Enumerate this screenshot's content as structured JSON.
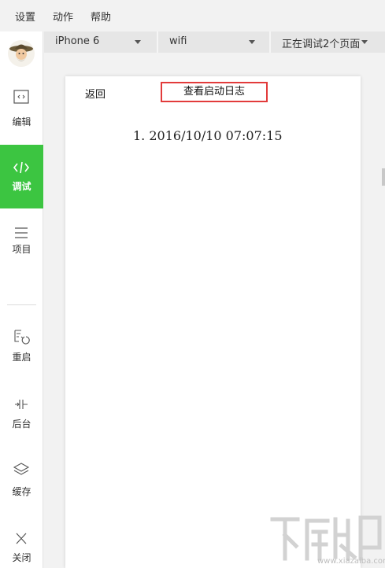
{
  "menubar": {
    "items": [
      {
        "label": "设置"
      },
      {
        "label": "动作"
      },
      {
        "label": "帮助"
      }
    ]
  },
  "toolbar": {
    "device": "iPhone 6",
    "network": "wifi",
    "debug_pages": "正在调试2个页面"
  },
  "sidebar": {
    "items": [
      {
        "label": "编辑",
        "icon": "code-icon"
      },
      {
        "label": "调试",
        "icon": "debug-icon",
        "active": true
      },
      {
        "label": "项目",
        "icon": "menu-icon"
      },
      {
        "label": "重启",
        "icon": "restart-icon"
      },
      {
        "label": "后台",
        "icon": "background-icon"
      },
      {
        "label": "缓存",
        "icon": "layers-icon"
      },
      {
        "label": "关闭",
        "icon": "close-icon"
      }
    ]
  },
  "simulator": {
    "back_label": "返回",
    "view_log_label": "查看启动日志",
    "log_entries": [
      "1.  2016/10/10  07:07:15"
    ]
  },
  "colors": {
    "active_green": "#3cc541",
    "highlight_red": "#e23b3b"
  },
  "watermark": {
    "sub": "www.xiazaiba.com"
  }
}
